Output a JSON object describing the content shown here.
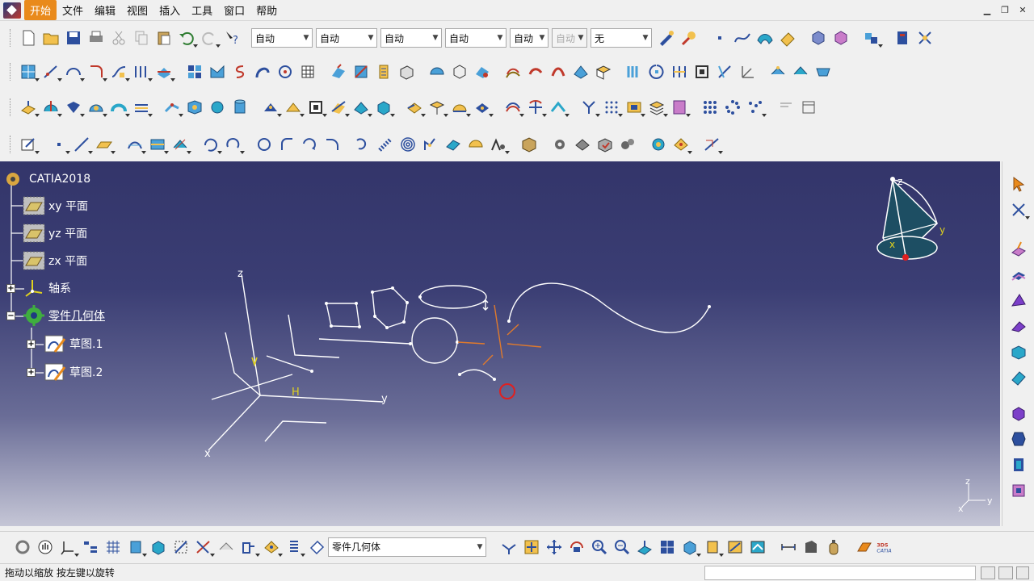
{
  "menubar": {
    "items": [
      "开始",
      "文件",
      "编辑",
      "视图",
      "插入",
      "工具",
      "窗口",
      "帮助"
    ],
    "active_index": 0
  },
  "window_controls": [
    "minimize",
    "restore",
    "close"
  ],
  "toolbar": {
    "combos": [
      {
        "value": "自动"
      },
      {
        "value": "自动"
      },
      {
        "value": "自动"
      },
      {
        "value": "自动"
      },
      {
        "value": "自动"
      },
      {
        "value": "自动",
        "disabled": true
      },
      {
        "value": "无"
      }
    ]
  },
  "tree": {
    "root": "CATIA2018",
    "items": [
      {
        "label": "xy 平面",
        "icon": "plane-icon"
      },
      {
        "label": "yz 平面",
        "icon": "plane-icon"
      },
      {
        "label": "zx 平面",
        "icon": "plane-icon"
      },
      {
        "label": "轴系",
        "icon": "axis-system-icon"
      },
      {
        "label": "零件几何体",
        "icon": "part-body-icon"
      },
      {
        "label": "草图.1",
        "icon": "sketch-icon"
      },
      {
        "label": "草图.2",
        "icon": "sketch-icon"
      }
    ]
  },
  "viewport": {
    "axis_labels": {
      "z": "z",
      "y": "y",
      "x": "x",
      "h": "H",
      "v": "V"
    },
    "compass_labels": {
      "z": "z",
      "y": "y",
      "x": "x"
    },
    "mini_axis": {
      "z": "z",
      "y": "y",
      "x": "x"
    }
  },
  "bottom": {
    "current_body": "零件几何体"
  },
  "status": {
    "message": "拖动以缩放 按左键以旋转"
  },
  "colors": {
    "active_menu": "#e98a1c",
    "viewport_top": "#33356a",
    "viewport_bottom": "#c5c6d6",
    "geometry": "#ffffff",
    "construction": "#e07a2c",
    "selection": "#e02020"
  }
}
